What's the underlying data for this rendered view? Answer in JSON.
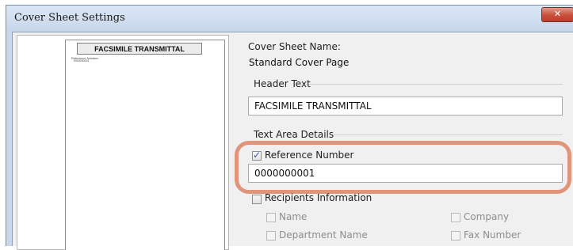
{
  "window": {
    "title": "Cover Sheet Settings",
    "close_glyph": "✕"
  },
  "preview": {
    "header_text": "FACSIMILE TRANSMITTAL",
    "ref_label": "Reference Number:",
    "ref_value": "0000000001"
  },
  "cover_sheet_name": {
    "label": "Cover Sheet Name:",
    "value": "Standard Cover Page"
  },
  "header_text": {
    "group_label": "Header Text",
    "value": "FACSIMILE TRANSMITTAL"
  },
  "text_area_details": {
    "group_label": "Text Area Details",
    "reference_number": {
      "label": "Reference Number",
      "checked": true,
      "value": "0000000001"
    },
    "recipients_information": {
      "label": "Recipients Information",
      "checked": false
    },
    "name": {
      "label": "Name",
      "checked": false
    },
    "company": {
      "label": "Company",
      "checked": false
    },
    "department_name": {
      "label": "Department Name",
      "checked": false
    },
    "fax_number": {
      "label": "Fax Number",
      "checked": false
    }
  },
  "colors": {
    "titlebar": "#c6d6ea",
    "close_button": "#c84e3a",
    "highlight": "#e0957a",
    "check": "#2d5bb5"
  }
}
